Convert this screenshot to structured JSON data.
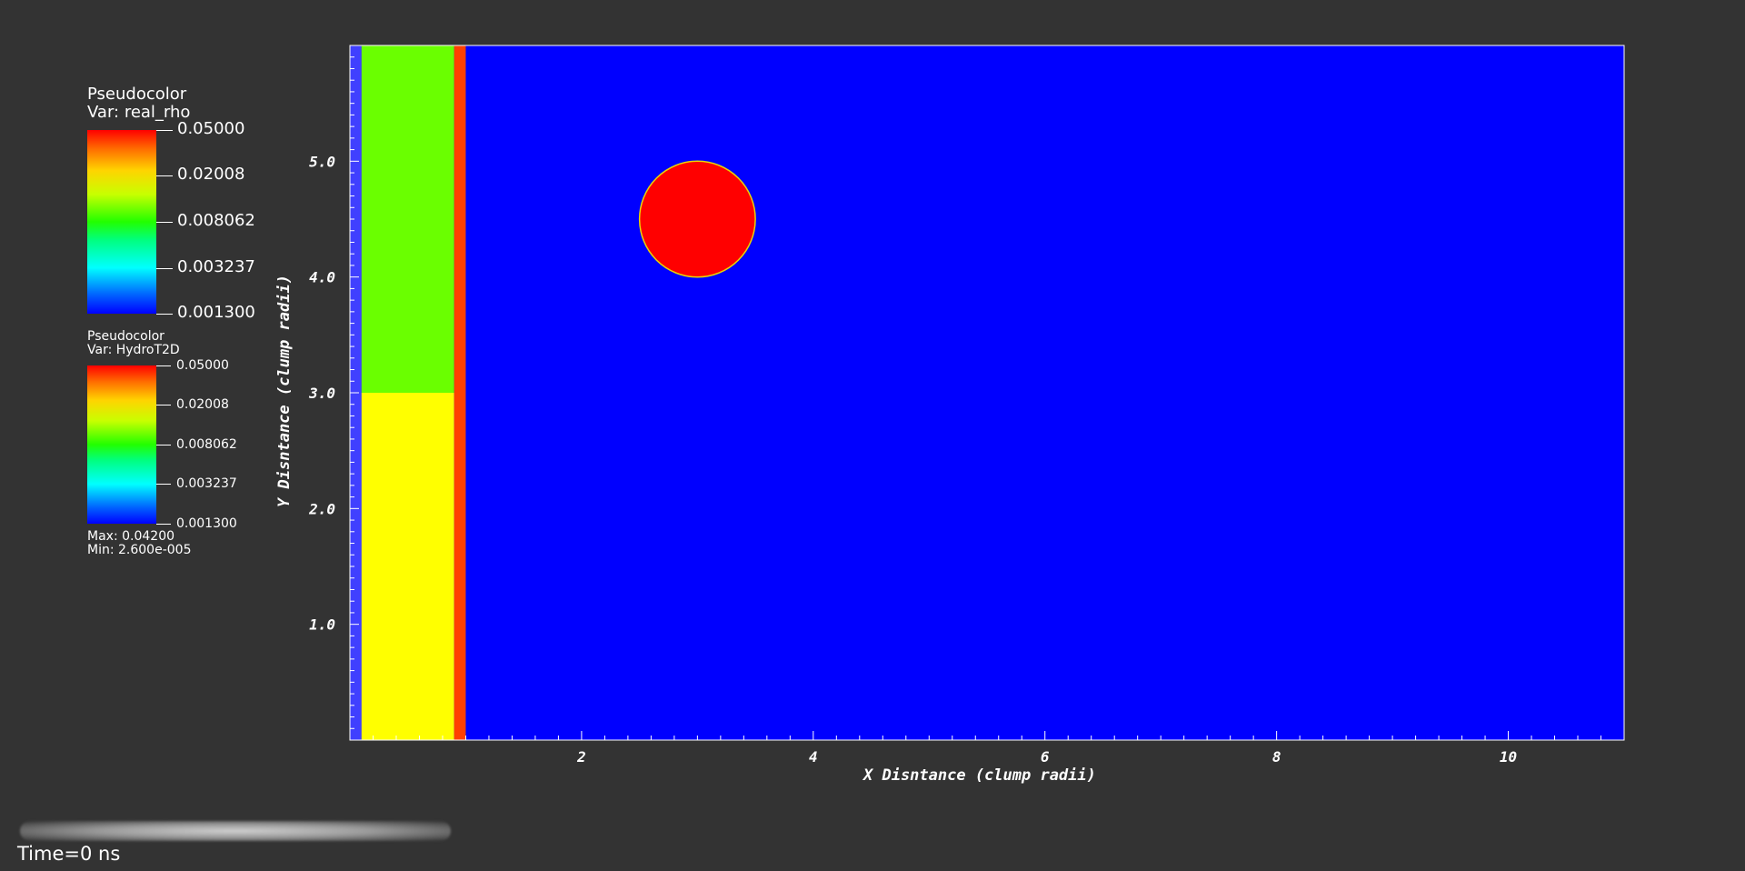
{
  "legend1": {
    "title": "Pseudocolor",
    "var": "Var: real_rho",
    "ticks": [
      "0.05000",
      "0.02008",
      "0.008062",
      "0.003237",
      "0.001300"
    ]
  },
  "legend2": {
    "title": "Pseudocolor",
    "var": "Var: HydroT2D",
    "ticks": [
      "0.05000",
      "0.02008",
      "0.008062",
      "0.003237",
      "0.001300"
    ],
    "max": "Max:  0.04200",
    "min": "Min:  2.600e-005"
  },
  "plot": {
    "background_color": "#0000ff",
    "x_axis_label": "X Disntance (clump radii)",
    "y_axis_label": "Y Disntance (clump radii)",
    "x_ticks": [
      "2",
      "4",
      "6",
      "8",
      "10"
    ],
    "y_ticks": [
      "1.0",
      "2.0",
      "3.0",
      "4.0",
      "5.0"
    ],
    "x_range": [
      0,
      11
    ],
    "y_range": [
      0,
      6
    ],
    "regions": [
      {
        "name": "left-sliver",
        "x0": 0.0,
        "x1": 0.1,
        "y0": 0,
        "y1": 6,
        "color": "#4040ff"
      },
      {
        "name": "green-slab",
        "x0": 0.1,
        "x1": 0.9,
        "y0": 3,
        "y1": 6,
        "color": "#6aff00"
      },
      {
        "name": "yellow-slab",
        "x0": 0.1,
        "x1": 0.9,
        "y0": 0,
        "y1": 3,
        "color": "#ffff00"
      },
      {
        "name": "orange-strip",
        "x0": 0.9,
        "x1": 1.0,
        "y0": 0,
        "y1": 6,
        "color": "#ff4000"
      }
    ],
    "clump": {
      "cx": 3.0,
      "cy": 4.5,
      "r": 0.5,
      "fill": "#ff0000",
      "stroke": "#e8d400"
    }
  },
  "status": {
    "time": "Time=0 ns"
  }
}
